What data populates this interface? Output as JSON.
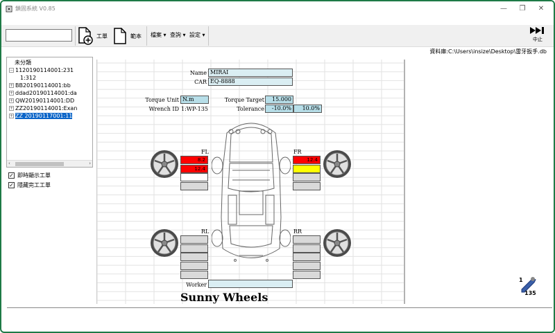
{
  "window": {
    "title": "鎖固系統 V0.85",
    "controls": {
      "minimize": "—",
      "restore": "❐",
      "close": "✕"
    }
  },
  "toolbar": {
    "work_order": "工單",
    "template": "範本",
    "menus": [
      "檔案",
      "查詢",
      "設定"
    ],
    "stop": "中止"
  },
  "db_path": "資料庫:C:\\Users\\insize\\Desktop\\雷牙扳手.db",
  "tree": {
    "items": [
      {
        "label": "未分類",
        "indent": 1,
        "expander": ""
      },
      {
        "label": "1120190114001:231",
        "indent": 0,
        "expander": "−"
      },
      {
        "label": "1:312",
        "indent": 2,
        "expander": ""
      },
      {
        "label": "BB20190114001:bb",
        "indent": 0,
        "expander": "+"
      },
      {
        "label": "ddad20190114001:da",
        "indent": 0,
        "expander": "+"
      },
      {
        "label": "QW20190114001:DD",
        "indent": 0,
        "expander": "+"
      },
      {
        "label": "ZZ20190114001:Exan",
        "indent": 0,
        "expander": "+"
      },
      {
        "label": "ZZ 20190117001:11",
        "indent": 0,
        "expander": "+",
        "selected": true
      }
    ]
  },
  "options": {
    "show_realtime": "即時顯示工單",
    "hide_completed": "隱藏完工工單"
  },
  "form": {
    "name_label": "Name",
    "name_value": "MIRAI",
    "car_label": "CAR",
    "car_value": "EQ-8888",
    "torque_unit_label": "Torque Unit",
    "torque_unit_value": "N.m",
    "torque_target_label": "Torque Target",
    "torque_target_value": "15.000",
    "wrench_id_label": "Wrench ID",
    "wrench_id_value": "1:WP-135",
    "tolerance_label": "Tolerance",
    "tolerance_min": "-10.0%",
    "tolerance_max": "10.0%",
    "worker_label": "Worker",
    "worker_value": ""
  },
  "wheels": {
    "fl": {
      "label": "FL",
      "values": [
        "8.2",
        "12.4",
        "",
        ""
      ],
      "colors": [
        "#ff0000",
        "#ff0000",
        "#ffffff",
        "#d9d9d9"
      ]
    },
    "fr": {
      "label": "FR",
      "values": [
        "12.4",
        "",
        "",
        ""
      ],
      "colors": [
        "#ff0000",
        "#ffff00",
        "#d9d9d9",
        "#d9d9d9"
      ]
    },
    "rl": {
      "label": "RL",
      "values": [
        "",
        "",
        "",
        "",
        ""
      ],
      "colors": [
        "#d9d9d9",
        "#d9d9d9",
        "#d9d9d9",
        "#d9d9d9",
        "#d9d9d9"
      ]
    },
    "rr": {
      "label": "RR",
      "values": [
        "",
        "",
        "",
        "",
        ""
      ],
      "colors": [
        "#d9d9d9",
        "#d9d9d9",
        "#d9d9d9",
        "#d9d9d9",
        "#d9d9d9"
      ]
    }
  },
  "brand": "Sunny Wheels",
  "wrench_badge": {
    "top": "1",
    "bottom": "135"
  },
  "colors": {
    "accent": "#1e7a46",
    "selection": "#0a64c8",
    "cell_blue": "#daeef3"
  }
}
